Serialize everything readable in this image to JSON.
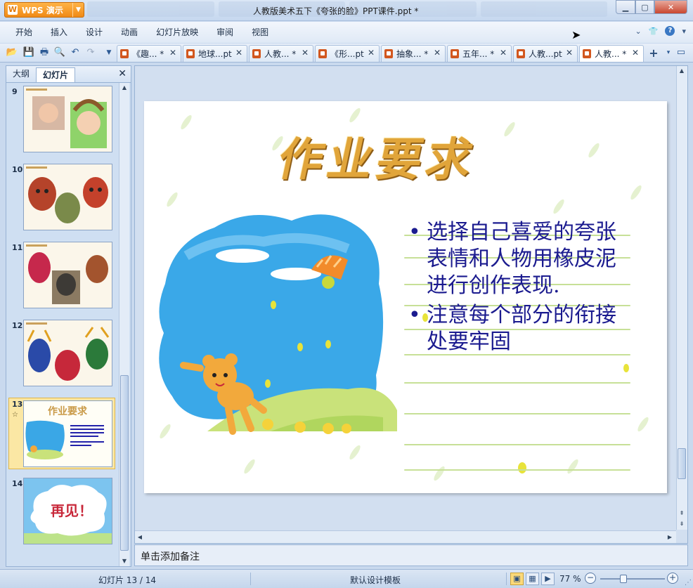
{
  "titlebar": {
    "app_label": "WPS 演示",
    "window_title": "人教版美术五下《夸张的脸》PPT课件.ppt *"
  },
  "menu": {
    "items": [
      "开始",
      "插入",
      "设计",
      "动画",
      "幻灯片放映",
      "审阅",
      "视图"
    ]
  },
  "toolbar": {
    "quick_icons": [
      "open-icon",
      "save-icon",
      "print-icon",
      "print-preview-icon",
      "undo-icon",
      "redo-icon",
      "customize-icon"
    ],
    "doc_tabs": [
      {
        "label": "《趣... *",
        "active": false
      },
      {
        "label": "地球...pt",
        "active": false
      },
      {
        "label": "人教... *",
        "active": false
      },
      {
        "label": "《形...pt",
        "active": false
      },
      {
        "label": "抽象... *",
        "active": false
      },
      {
        "label": "五年... *",
        "active": false
      },
      {
        "label": "人教...pt",
        "active": false
      },
      {
        "label": "人教... *",
        "active": true
      }
    ]
  },
  "left_panel": {
    "tabs": [
      {
        "label": "大纲",
        "active": false
      },
      {
        "label": "幻灯片",
        "active": true
      }
    ],
    "thumbnails": [
      {
        "num": "9"
      },
      {
        "num": "10"
      },
      {
        "num": "11"
      },
      {
        "num": "12"
      },
      {
        "num": "13",
        "selected": true,
        "title": "作业要求"
      },
      {
        "num": "14",
        "title": "再见！"
      }
    ]
  },
  "slide": {
    "title": "作业要求",
    "bullets": [
      "选择自己喜爱的夸张表情和人物用橡皮泥进行创作表现.",
      "注意每个部分的衔接处要牢固"
    ]
  },
  "notes": {
    "placeholder": "单击添加备注"
  },
  "statusbar": {
    "slide_indicator": "幻灯片 13 / 14",
    "template_name": "默认设计模板",
    "zoom": "77 %"
  },
  "colors": {
    "accent_orange": "#f08a16",
    "slide_text_blue": "#1b1b8f",
    "title_gold": "#e1a53a"
  }
}
